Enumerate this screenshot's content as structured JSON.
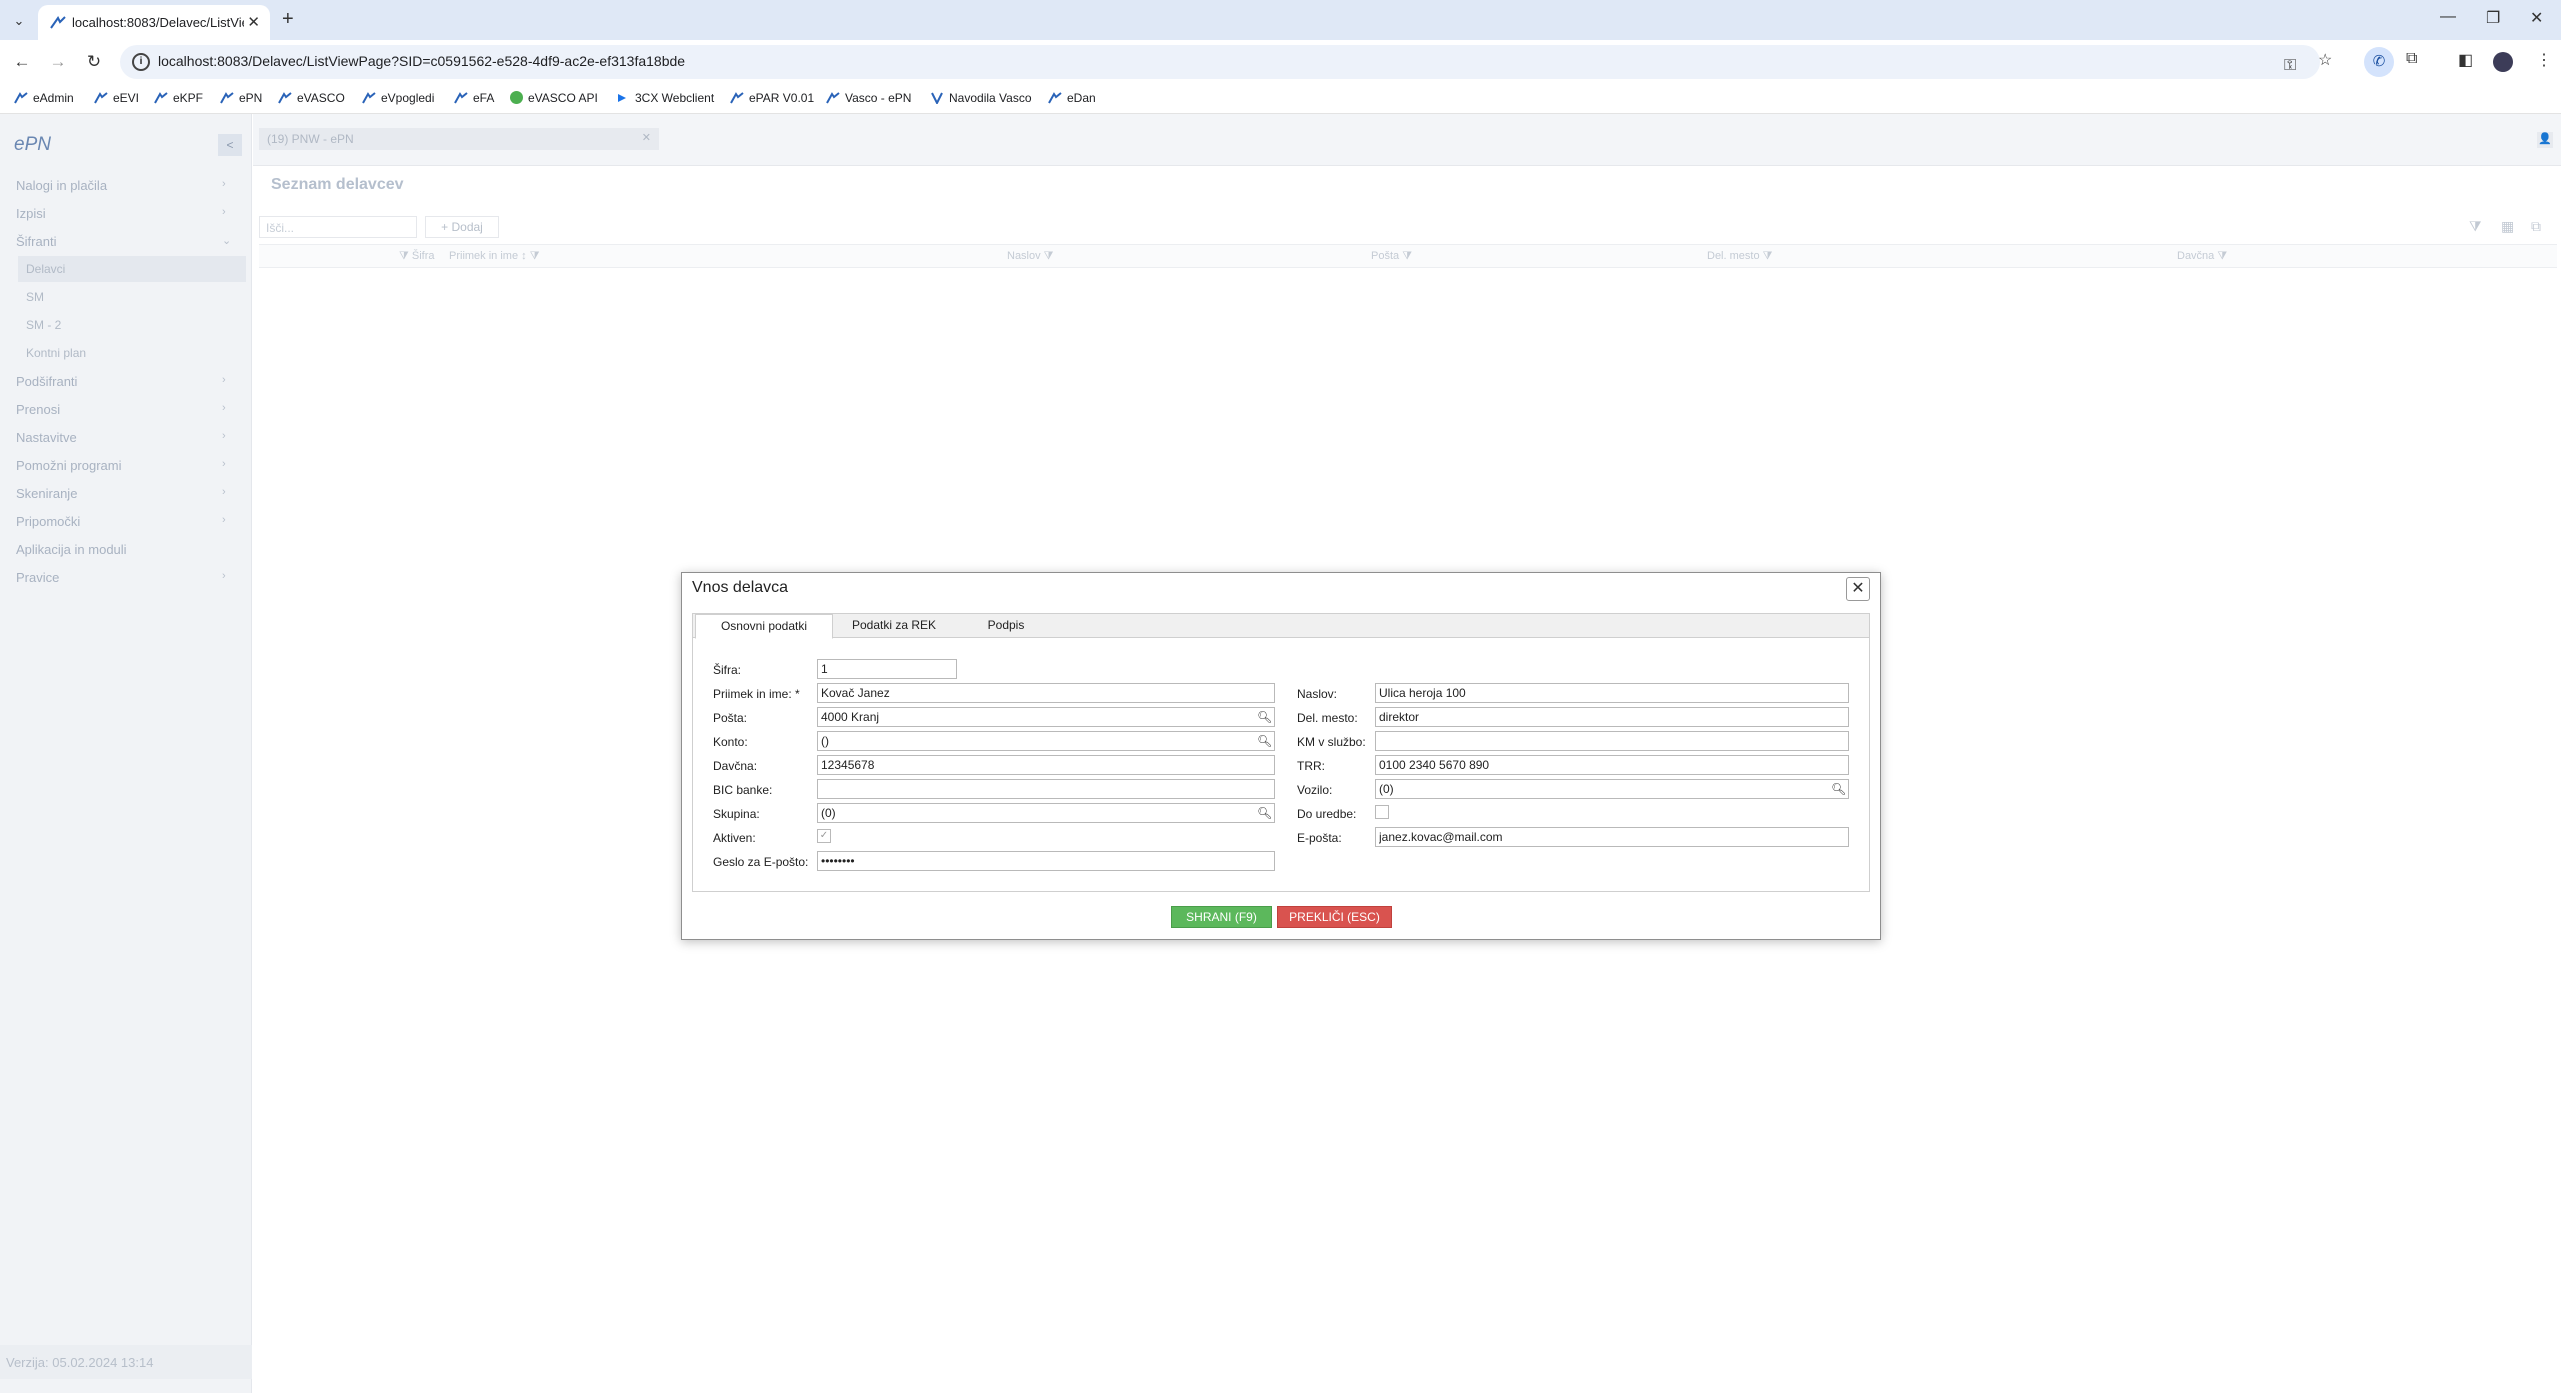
{
  "browser": {
    "tab_title": "localhost:8083/Delavec/ListVie",
    "url": "localhost:8083/Delavec/ListViewPage?SID=c0591562-e528-4df9-ac2e-ef313fa18bde",
    "bookmarks": [
      "eAdmin",
      "eEVI",
      "eKPF",
      "ePN",
      "eVASCO",
      "eVpogledi",
      "eFA",
      "eVASCO API",
      "3CX Webclient",
      "ePAR V0.01",
      "Vasco - ePN",
      "Navodila Vasco",
      "eDan"
    ]
  },
  "sidebar": {
    "logo": "ePN",
    "items": [
      {
        "label": "Nalogi in plačila"
      },
      {
        "label": "Izpisi"
      },
      {
        "label": "Šifranti"
      },
      {
        "label": "Podšifranti"
      },
      {
        "label": "Prenosi"
      },
      {
        "label": "Nastavitve"
      },
      {
        "label": "Pomožni programi"
      },
      {
        "label": "Skeniranje"
      },
      {
        "label": "Pripomočki"
      },
      {
        "label": "Aplikacija in moduli"
      },
      {
        "label": "Pravice"
      }
    ],
    "subitems": [
      "Delavci",
      "SM",
      "SM - 2",
      "Kontni plan"
    ],
    "version": "Verzija: 05.02.2024 13:14"
  },
  "main": {
    "breadcrumb": "(19) PNW - ePN",
    "title": "Seznam delavcev",
    "search_placeholder": "Išči...",
    "add_label": "Dodaj",
    "columns": [
      "Šifra",
      "Priimek in ime",
      "Naslov",
      "Pošta",
      "Del. mesto",
      "Davčna"
    ]
  },
  "dialog": {
    "title": "Vnos delavca",
    "tabs": [
      "Osnovni podatki",
      "Podatki za REK",
      "Podpis"
    ],
    "left_labels": {
      "sifra": "Šifra:",
      "priimek": "Priimek in ime: *",
      "posta": "Pošta:",
      "konto": "Konto:",
      "davcna": "Davčna:",
      "bic": "BIC banke:",
      "skupina": "Skupina:",
      "aktiven": "Aktiven:",
      "geslo": "Geslo za E-pošto:"
    },
    "left_values": {
      "sifra": "1",
      "priimek": "Kovač Janez",
      "posta": "4000 Kranj",
      "konto": "()",
      "davcna": "12345678",
      "bic": "",
      "skupina": "(0)",
      "geslo": "••••••••"
    },
    "right_labels": {
      "naslov": "Naslov:",
      "delmesto": "Del. mesto:",
      "km": "KM v službo:",
      "trr": "TRR:",
      "vozilo": "Vozilo:",
      "douredbe": "Do uredbe:",
      "eposta": "E-pošta:"
    },
    "right_values": {
      "naslov": "Ulica heroja 100",
      "delmesto": "direktor",
      "km": "",
      "trr": "0100 2340 5670 890",
      "vozilo": "(0)",
      "eposta": "janez.kovac@mail.com"
    },
    "aktiven_checked": true,
    "douredbe_checked": false,
    "save_label": "SHRANI (F9)",
    "cancel_label": "PREKLIČI (ESC)"
  },
  "colors": {
    "save": "#5cb85c",
    "cancel": "#d9534f",
    "browser_frame": "#dfe8f6"
  }
}
